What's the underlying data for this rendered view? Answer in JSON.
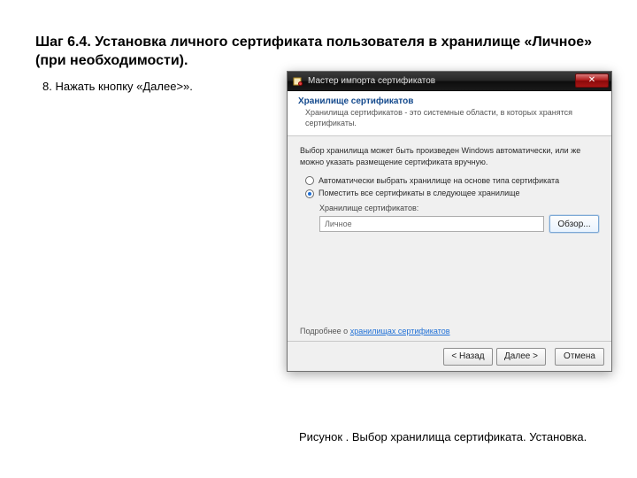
{
  "page": {
    "heading": "Шаг 6.4. Установка личного сертификата пользователя в хранилище «Личное» (при необходимости).",
    "instruction": "8. Нажать кнопку «Далее>».",
    "caption": "Рисунок . Выбор хранилища сертификата. Установка."
  },
  "wizard": {
    "title": "Мастер импорта сертификатов",
    "close_glyph": "✕",
    "step": {
      "title": "Хранилище сертификатов",
      "desc": "Хранилища сертификатов - это системные области, в которых хранятся сертификаты."
    },
    "intro": "Выбор хранилища может быть произведен Windows автоматически, или же можно указать размещение сертификата вручную.",
    "opt_auto": "Автоматически выбрать хранилище на основе типа сертификата",
    "opt_manual": "Поместить все сертификаты в следующее хранилище",
    "store_label": "Хранилище сертификатов:",
    "store_value": "Личное",
    "browse": "Обзор...",
    "more_prefix": "Подробнее о ",
    "more_link": "хранилищах сертификатов",
    "btn_back": "< Назад",
    "btn_next": "Далее >",
    "btn_cancel": "Отмена"
  }
}
